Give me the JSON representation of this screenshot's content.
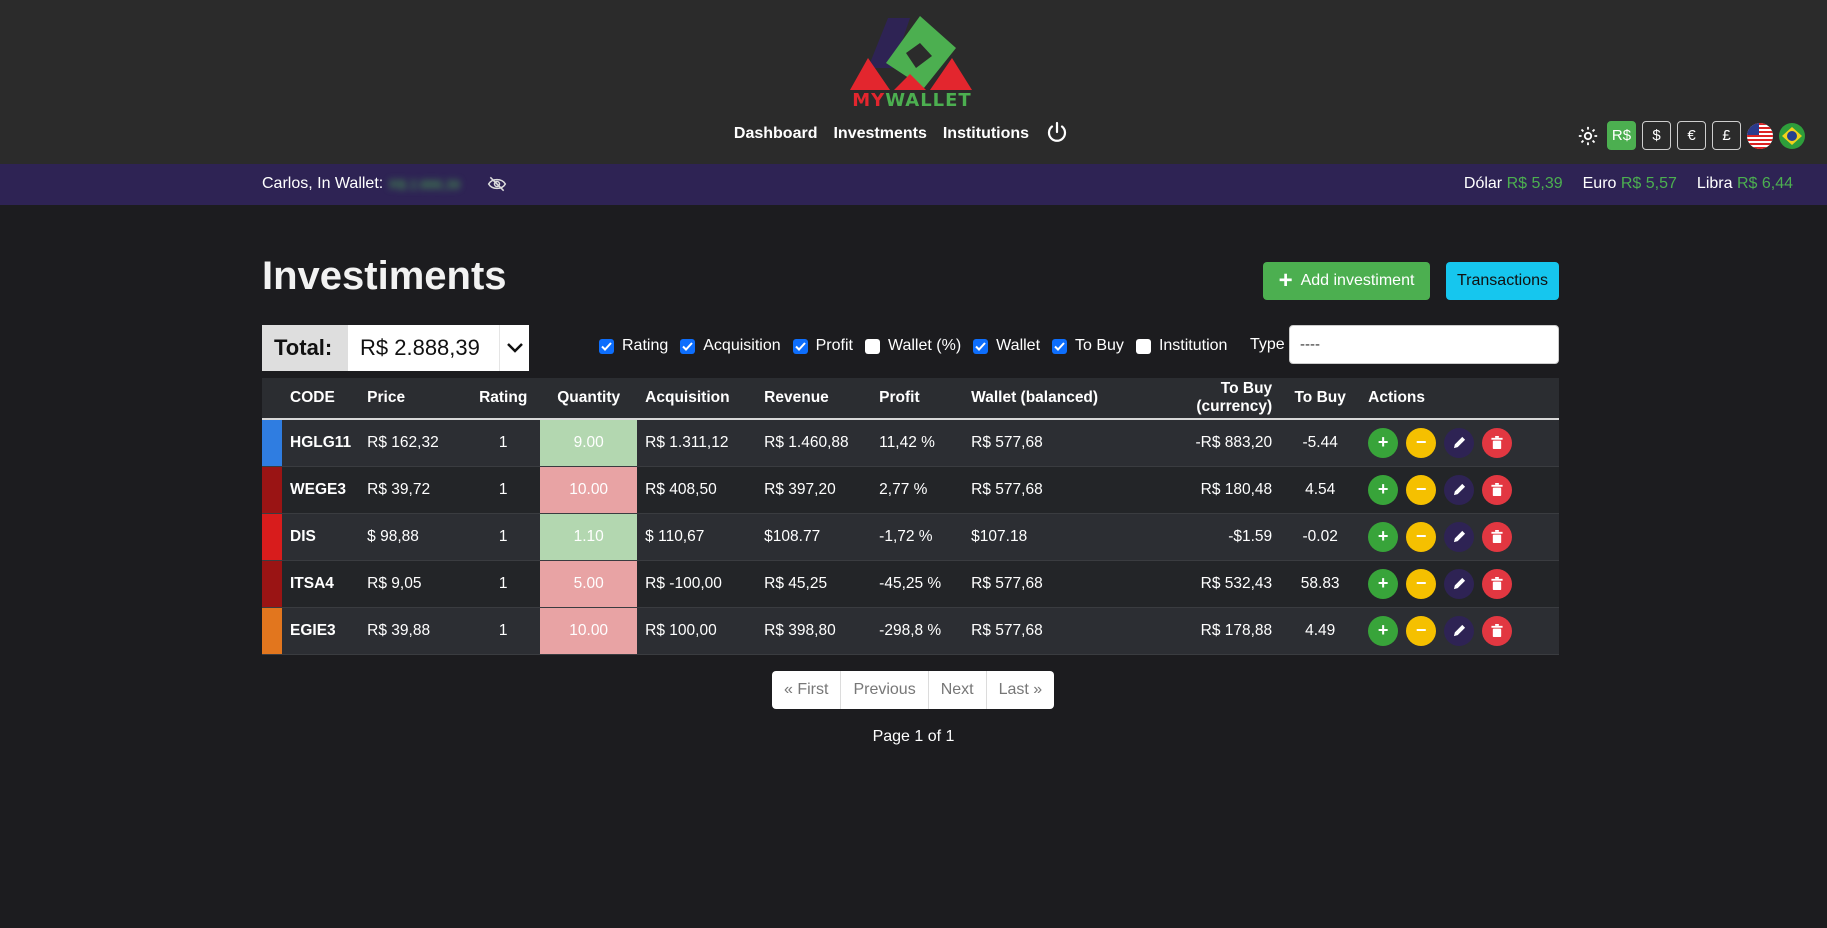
{
  "brand": {
    "my": "MY",
    "wallet": "WALLET"
  },
  "nav": {
    "dashboard": "Dashboard",
    "investments": "Investments",
    "institutions": "Institutions"
  },
  "currency_buttons": [
    {
      "label": "R$",
      "active": true
    },
    {
      "label": "$",
      "active": false
    },
    {
      "label": "€",
      "active": false
    },
    {
      "label": "£",
      "active": false
    }
  ],
  "infobar": {
    "greeting": "Carlos, In Wallet:",
    "wallet_value": "R$ 2.888,39",
    "rates": [
      {
        "name": "Dólar",
        "value": "R$ 5,39"
      },
      {
        "name": "Euro",
        "value": "R$ 5,57"
      },
      {
        "name": "Libra",
        "value": "R$ 6,44"
      }
    ]
  },
  "page": {
    "title": "Investiments",
    "add_button": "Add investiment",
    "transactions_button": "Transactions"
  },
  "total": {
    "label": "Total:",
    "value": "R$ 2.888,39"
  },
  "filters": [
    {
      "label": "Rating",
      "checked": true
    },
    {
      "label": "Acquisition",
      "checked": true
    },
    {
      "label": "Profit",
      "checked": true
    },
    {
      "label": "Wallet (%)",
      "checked": false
    },
    {
      "label": "Wallet",
      "checked": true
    },
    {
      "label": "To Buy",
      "checked": true
    },
    {
      "label": "Institution",
      "checked": false
    }
  ],
  "type_filter": {
    "label": "Type",
    "value": "----"
  },
  "table": {
    "headers": {
      "code": "CODE",
      "price": "Price",
      "rating": "Rating",
      "quantity": "Quantity",
      "acquisition": "Acquisition",
      "revenue": "Revenue",
      "profit": "Profit",
      "wallet": "Wallet (balanced)",
      "to_buy_currency": "To Buy (currency)",
      "to_buy": "To Buy",
      "actions": "Actions"
    },
    "rows": [
      {
        "color": "#2f7de1",
        "code": "HGLG11",
        "price": "R$ 162,32",
        "rating": "1",
        "quantity": "9.00",
        "qty_status": "good",
        "acquisition": "R$ 1.311,12",
        "revenue": "R$ 1.460,88",
        "profit": "11,42 %",
        "wallet": "R$ 577,68",
        "to_buy_currency": "-R$ 883,20",
        "to_buy": "-5.44"
      },
      {
        "color": "#9a1414",
        "code": "WEGE3",
        "price": "R$ 39,72",
        "rating": "1",
        "quantity": "10.00",
        "qty_status": "bad",
        "acquisition": "R$ 408,50",
        "revenue": "R$ 397,20",
        "profit": "2,77 %",
        "wallet": "R$ 577,68",
        "to_buy_currency": "R$ 180,48",
        "to_buy": "4.54"
      },
      {
        "color": "#d81c1c",
        "code": "DIS",
        "price": "$ 98,88",
        "rating": "1",
        "quantity": "1.10",
        "qty_status": "good",
        "acquisition": "$ 110,67",
        "revenue": "$108.77",
        "profit": "-1,72 %",
        "wallet": "$107.18",
        "to_buy_currency": "-$1.59",
        "to_buy": "-0.02"
      },
      {
        "color": "#9a1414",
        "code": "ITSA4",
        "price": "R$ 9,05",
        "rating": "1",
        "quantity": "5.00",
        "qty_status": "bad",
        "acquisition": "R$ -100,00",
        "revenue": "R$ 45,25",
        "profit": "-45,25 %",
        "wallet": "R$ 577,68",
        "to_buy_currency": "R$ 532,43",
        "to_buy": "58.83"
      },
      {
        "color": "#e2761e",
        "code": "EGIE3",
        "price": "R$ 39,88",
        "rating": "1",
        "quantity": "10.00",
        "qty_status": "bad",
        "acquisition": "R$ 100,00",
        "revenue": "R$ 398,80",
        "profit": "-298,8 %",
        "wallet": "R$ 577,68",
        "to_buy_currency": "R$ 178,88",
        "to_buy": "4.49"
      }
    ]
  },
  "pagination": {
    "first": "« First",
    "previous": "Previous",
    "next": "Next",
    "last": "Last »",
    "info": "Page 1 of 1"
  },
  "colors": {
    "accent_green": "#4caf50",
    "info_bar": "#2e2354",
    "danger": "#e23741",
    "warning": "#f5c000"
  }
}
